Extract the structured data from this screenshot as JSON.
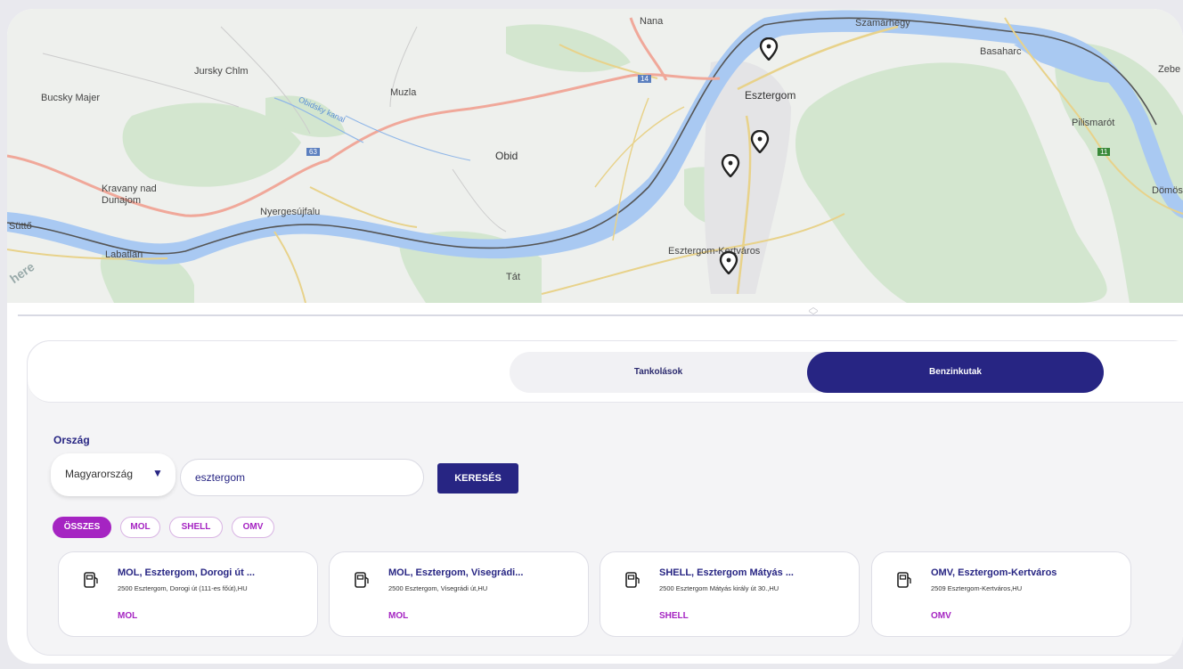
{
  "map": {
    "labels": [
      "Nana",
      "Szamárhegy",
      "Basaharc",
      "Zebe",
      "Jursky Chlm",
      "Bucsky Majer",
      "Muzla",
      "Esztergom",
      "Pilismarót",
      "Obid",
      "Kravany nad",
      "Dunajom",
      "Nyergesújfalu",
      "Süttő",
      "Labatlan",
      "Esztergom-Kertváros",
      "Tát",
      "Dömös",
      "Obidsky kanal",
      "here"
    ],
    "road_shields": [
      "14",
      "63",
      "11"
    ],
    "pin_icon": "map-pin-icon",
    "water_color": "#a9c9f2",
    "land_color": "#d3e6cf"
  },
  "tabs": [
    {
      "label": "Tankolások",
      "active": false
    },
    {
      "label": "Benzinkutak",
      "active": true
    }
  ],
  "search": {
    "country_label": "Ország",
    "country_value": "Magyarország",
    "query": "esztergom",
    "button": "KERESÉS"
  },
  "filters": [
    {
      "label": "ÖSSZES",
      "active": true
    },
    {
      "label": "MOL",
      "active": false
    },
    {
      "label": "SHELL",
      "active": false
    },
    {
      "label": "OMV",
      "active": false
    }
  ],
  "stations": [
    {
      "title": "MOL, Esztergom, Dorogi út ...",
      "address": "2500 Esztergom, Dorogi út (111-es főút),HU",
      "brand": "MOL",
      "icon": "fuel-pump-icon"
    },
    {
      "title": "MOL, Esztergom, Visegrádi...",
      "address": "2500 Esztergom, Visegrádi út,HU",
      "brand": "MOL",
      "icon": "fuel-pump-icon"
    },
    {
      "title": "SHELL, Esztergom Mátyás ...",
      "address": "2500 Esztergom Mátyás király út 30.,HU",
      "brand": "SHELL",
      "icon": "fuel-pump-icon"
    },
    {
      "title": "OMV, Esztergom-Kertváros",
      "address": "2509 Esztergom-Kertváros,HU",
      "brand": "OMV",
      "icon": "fuel-pump-icon"
    }
  ],
  "colors": {
    "primary": "#272583",
    "accent": "#a524c2"
  }
}
